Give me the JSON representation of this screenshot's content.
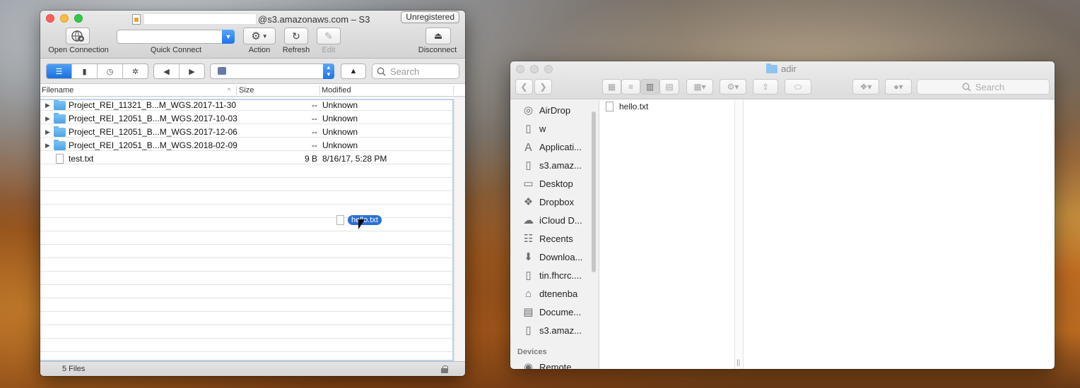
{
  "s3_window": {
    "title_suffix": "@s3.amazonaws.com – S3",
    "unregistered": "Unregistered",
    "toolbar": {
      "open_connection": "Open Connection",
      "quick_connect": "Quick Connect",
      "action": "Action",
      "refresh": "Refresh",
      "edit": "Edit",
      "disconnect": "Disconnect"
    },
    "nav": {
      "back_glyph": "◀",
      "forward_glyph": "▶",
      "up_glyph": "▲",
      "search_placeholder": "Search"
    },
    "columns": {
      "filename": "Filename",
      "size": "Size",
      "modified": "Modified"
    },
    "rows": [
      {
        "type": "folder",
        "name": "Project_REI_11321_B...M_WGS.2017-11-30",
        "size": "--",
        "modified": "Unknown"
      },
      {
        "type": "folder",
        "name": "Project_REI_12051_B...M_WGS.2017-10-03",
        "size": "--",
        "modified": "Unknown"
      },
      {
        "type": "folder",
        "name": "Project_REI_12051_B...M_WGS.2017-12-06",
        "size": "--",
        "modified": "Unknown"
      },
      {
        "type": "folder",
        "name": "Project_REI_12051_B...M_WGS.2018-02-09",
        "size": "--",
        "modified": "Unknown"
      },
      {
        "type": "file",
        "name": "test.txt",
        "size": "9 B",
        "modified": "8/16/17, 5:28 PM"
      }
    ],
    "drag_label": "hello.txt",
    "status": "5 Files"
  },
  "finder_window": {
    "title": "adir",
    "search_placeholder": "Search",
    "sidebar": [
      {
        "label": "AirDrop",
        "icon": "airdrop-icon"
      },
      {
        "label": "w",
        "icon": "document-icon"
      },
      {
        "label": "Applicati...",
        "icon": "applications-icon"
      },
      {
        "label": "s3.amaz...",
        "icon": "document-icon"
      },
      {
        "label": "Desktop",
        "icon": "desktop-icon"
      },
      {
        "label": "Dropbox",
        "icon": "dropbox-icon"
      },
      {
        "label": "iCloud D...",
        "icon": "cloud-icon"
      },
      {
        "label": "Recents",
        "icon": "recents-icon"
      },
      {
        "label": "Downloa...",
        "icon": "downloads-icon"
      },
      {
        "label": "tin.fhcrc....",
        "icon": "document-icon"
      },
      {
        "label": "dtenenba",
        "icon": "home-icon"
      },
      {
        "label": "Docume...",
        "icon": "documents-icon"
      },
      {
        "label": "s3.amaz...",
        "icon": "document-icon"
      }
    ],
    "devices_header": "Devices",
    "devices": [
      {
        "label": "Remote",
        "icon": "disc-icon"
      }
    ],
    "files": [
      "hello.txt"
    ]
  }
}
